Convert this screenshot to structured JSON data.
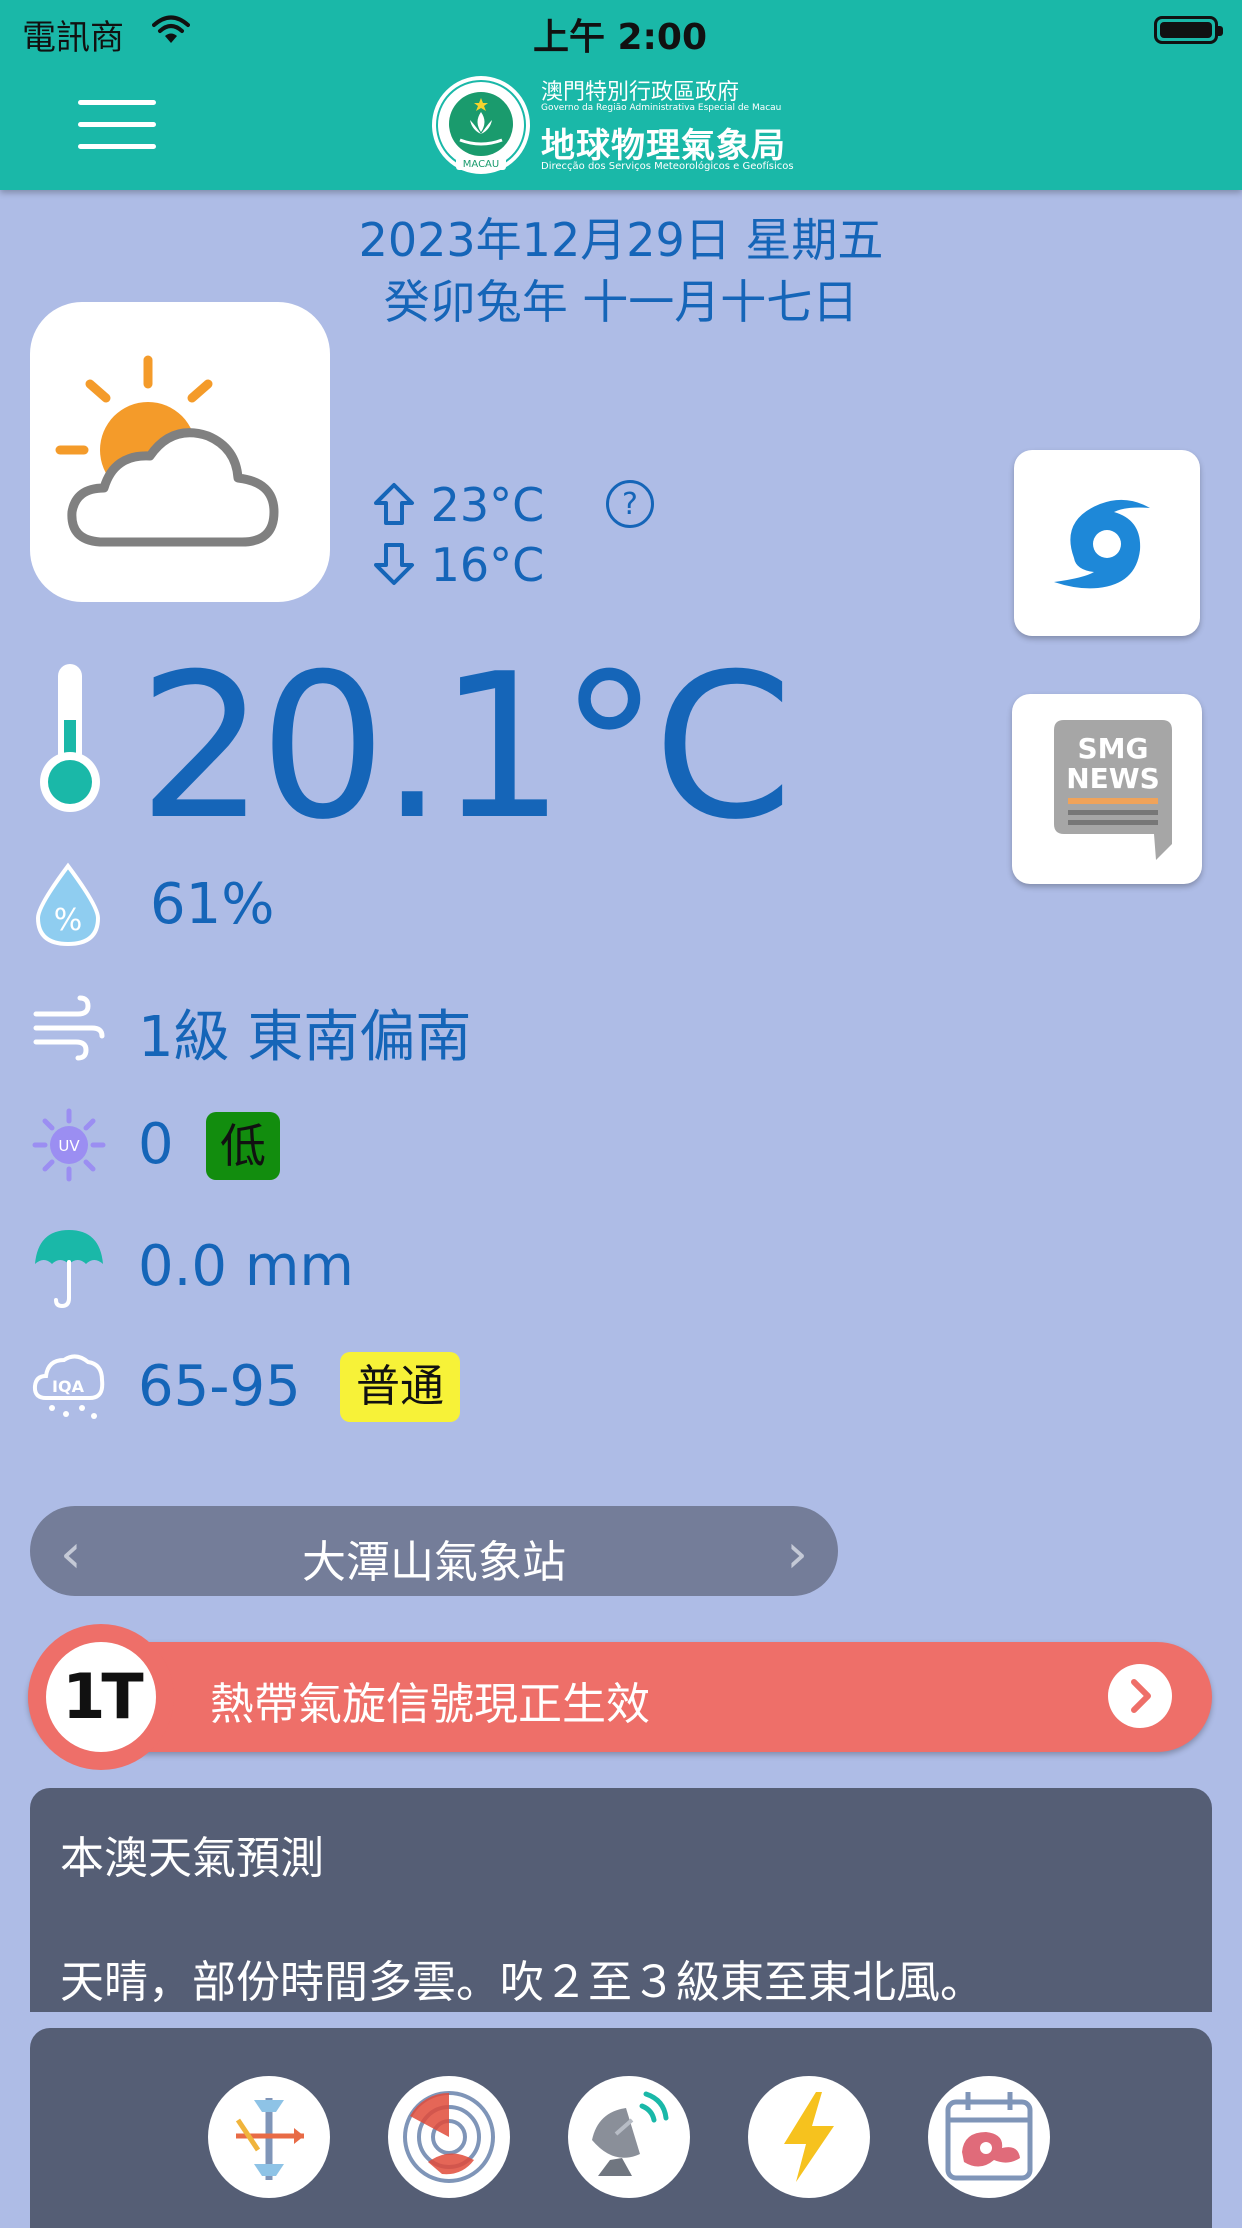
{
  "status_bar": {
    "carrier": "電訊商",
    "time": "上午 2:00"
  },
  "header": {
    "gov_name": "澳門特別行政區政府",
    "gov_name_pt": "Governo da Região Administrativa Especial de Macau",
    "org_name": "地球物理氣象局",
    "org_name_pt": "Direcção dos Serviços Meteorológicos e Geofísicos",
    "logo_text": "MACAU"
  },
  "date": {
    "gregorian": "2023年12月29日 星期五",
    "lunar": "癸卯兔年 十一月十七日"
  },
  "forecast_range": {
    "high": "23°C",
    "low": "16°C",
    "help": "?"
  },
  "current": {
    "temperature": "20.1°C",
    "humidity": "61%",
    "wind": "1級 東南偏南",
    "uv_value": "0",
    "uv_level": "低",
    "rainfall": "0.0 mm",
    "aqi_value": "65-95",
    "aqi_level": "普通",
    "aqi_icon_text": "IQA",
    "uv_icon_text": "UV"
  },
  "side_buttons": {
    "news_label_1": "SMG",
    "news_label_2": "NEWS"
  },
  "station": {
    "name": "大潭山氣象站",
    "prev": "‹",
    "next": "›"
  },
  "warning": {
    "signal": "1T",
    "text": "熱帶氣旋信號現正生效"
  },
  "forecast": {
    "title": "本澳天氣預測",
    "text": "天晴，部份時間多雲。吹２至３級東至東北風。"
  },
  "colors": {
    "header": "#1ab8a8",
    "background": "#aebce6",
    "text": "#1565b8",
    "warning": "#ee6f69",
    "panel": "#555e75",
    "uv_low": "#128d0e",
    "aqi_normal": "#f7f238"
  }
}
